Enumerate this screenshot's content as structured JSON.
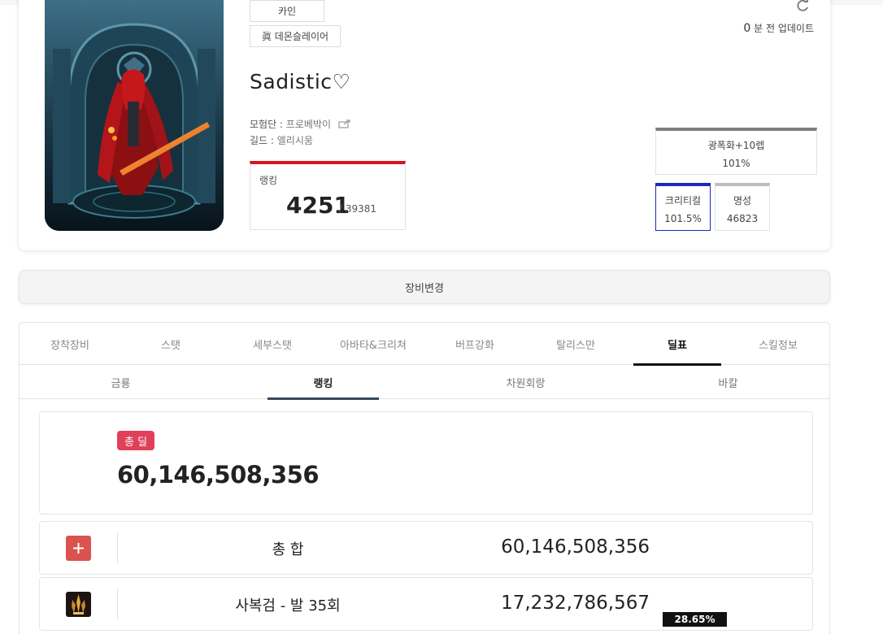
{
  "profile": {
    "server": "카인",
    "job": "眞 데몬슬레이어",
    "character_name": "Sadistic♡",
    "adventure_label": "모험단 : ",
    "adventure_name": "프로베박이",
    "guild_label": "길드 : ",
    "guild_name": "엘리시움",
    "rank_label": "랭킹",
    "rank_value": "4251",
    "rank_total": "/ 39381",
    "update_number": "0",
    "update_text": " 분 전 업데이트",
    "stats": {
      "rage": {
        "label": "광폭화+10렙",
        "value": "101%"
      },
      "crit": {
        "label": "크리티컬",
        "value": "101.5%"
      },
      "fame": {
        "label": "명성",
        "value": "46823"
      }
    }
  },
  "change_equip_label": "장비변경",
  "tabs": [
    "장착장비",
    "스탯",
    "세부스탯",
    "아바타&크리쳐",
    "버프강화",
    "탈리스만",
    "딜표",
    "스킬정보"
  ],
  "subtabs": [
    "금룡",
    "랭킹",
    "차원회랑",
    "바칼"
  ],
  "damage": {
    "total_badge": "총 딜",
    "total_value": "60,146,508,356",
    "rows": [
      {
        "label": "총 합",
        "value": "60,146,508,356"
      },
      {
        "label": "사복검 - 발 35회",
        "value": "17,232,786,567",
        "percent": "28.65%"
      }
    ]
  },
  "colors": {
    "rank_bar": "#d8141f",
    "crit_border": "#1a2ab8",
    "total_badge": "#e0405a",
    "plus_icon": "#d9534f",
    "subtab_underline": "#34495e"
  },
  "icons": {
    "refresh": "refresh-icon",
    "share": "share-icon",
    "plus": "plus-icon",
    "skill": "sword-skill-icon"
  }
}
